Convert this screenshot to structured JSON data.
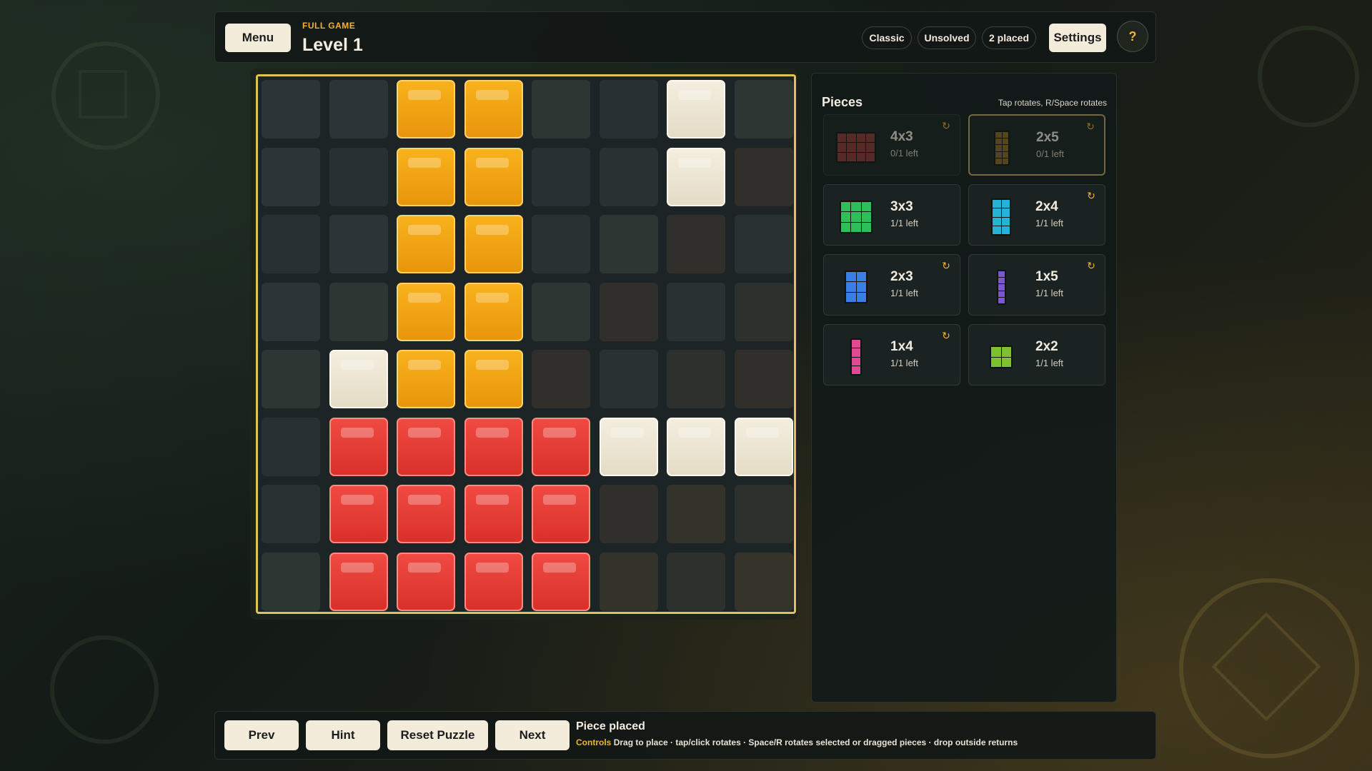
{
  "header": {
    "menu_label": "Menu",
    "subtitle": "FULL GAME",
    "title": "Level 1",
    "pills": [
      "Classic",
      "Unsolved",
      "2 placed"
    ],
    "settings_label": "Settings",
    "help_label": "?"
  },
  "board": {
    "size": 8,
    "frame_color": "#e2c05a",
    "tiles": [
      {
        "row": 0,
        "col": 2,
        "color": "orange"
      },
      {
        "row": 0,
        "col": 3,
        "color": "orange"
      },
      {
        "row": 0,
        "col": 6,
        "color": "cream"
      },
      {
        "row": 1,
        "col": 2,
        "color": "orange"
      },
      {
        "row": 1,
        "col": 3,
        "color": "orange"
      },
      {
        "row": 1,
        "col": 6,
        "color": "cream"
      },
      {
        "row": 2,
        "col": 2,
        "color": "orange"
      },
      {
        "row": 2,
        "col": 3,
        "color": "orange"
      },
      {
        "row": 3,
        "col": 2,
        "color": "orange"
      },
      {
        "row": 3,
        "col": 3,
        "color": "orange"
      },
      {
        "row": 4,
        "col": 1,
        "color": "cream"
      },
      {
        "row": 4,
        "col": 2,
        "color": "orange"
      },
      {
        "row": 4,
        "col": 3,
        "color": "orange"
      },
      {
        "row": 5,
        "col": 1,
        "color": "red"
      },
      {
        "row": 5,
        "col": 2,
        "color": "red"
      },
      {
        "row": 5,
        "col": 3,
        "color": "red"
      },
      {
        "row": 5,
        "col": 4,
        "color": "red"
      },
      {
        "row": 5,
        "col": 5,
        "color": "cream"
      },
      {
        "row": 5,
        "col": 6,
        "color": "cream"
      },
      {
        "row": 5,
        "col": 7,
        "color": "cream"
      },
      {
        "row": 6,
        "col": 1,
        "color": "red"
      },
      {
        "row": 6,
        "col": 2,
        "color": "red"
      },
      {
        "row": 6,
        "col": 3,
        "color": "red"
      },
      {
        "row": 6,
        "col": 4,
        "color": "red"
      },
      {
        "row": 7,
        "col": 1,
        "color": "red"
      },
      {
        "row": 7,
        "col": 2,
        "color": "red"
      },
      {
        "row": 7,
        "col": 3,
        "color": "red"
      },
      {
        "row": 7,
        "col": 4,
        "color": "red"
      }
    ]
  },
  "pieces_panel": {
    "title": "Pieces",
    "hint": "Tap rotates, R/Space rotates",
    "pieces": [
      {
        "name": "4x3",
        "left": "0/1 left",
        "color": "#8a3a34",
        "cols": 4,
        "rows": 3,
        "used": true,
        "selected": false,
        "rotate": true
      },
      {
        "name": "2x5",
        "left": "0/1 left",
        "color": "#8a6a2a",
        "cols": 2,
        "rows": 5,
        "used": true,
        "selected": true,
        "rotate": true
      },
      {
        "name": "3x3",
        "left": "1/1 left",
        "color": "#2fbf5a",
        "cols": 3,
        "rows": 3,
        "used": false,
        "selected": false,
        "rotate": false
      },
      {
        "name": "2x4",
        "left": "1/1 left",
        "color": "#22b4d2",
        "cols": 2,
        "rows": 4,
        "used": false,
        "selected": false,
        "rotate": true
      },
      {
        "name": "2x3",
        "left": "1/1 left",
        "color": "#3a7ee8",
        "cols": 2,
        "rows": 3,
        "used": false,
        "selected": false,
        "rotate": true
      },
      {
        "name": "1x5",
        "left": "1/1 left",
        "color": "#7b55d8",
        "cols": 1,
        "rows": 5,
        "used": false,
        "selected": false,
        "rotate": true
      },
      {
        "name": "1x4",
        "left": "1/1 left",
        "color": "#e04a90",
        "cols": 1,
        "rows": 4,
        "used": false,
        "selected": false,
        "rotate": true
      },
      {
        "name": "2x2",
        "left": "1/1 left",
        "color": "#7cc22e",
        "cols": 2,
        "rows": 2,
        "used": false,
        "selected": false,
        "rotate": false
      }
    ]
  },
  "footer": {
    "prev_label": "Prev",
    "hint_label": "Hint",
    "reset_label": "Reset Puzzle",
    "next_label": "Next",
    "status": "Piece placed",
    "controls_label": "Controls",
    "controls_text": "Drag to place · tap/click rotates · Space/R rotates selected or dragged pieces · drop outside returns"
  },
  "icons": {
    "rotate": "rotate-icon",
    "help": "question-icon"
  }
}
